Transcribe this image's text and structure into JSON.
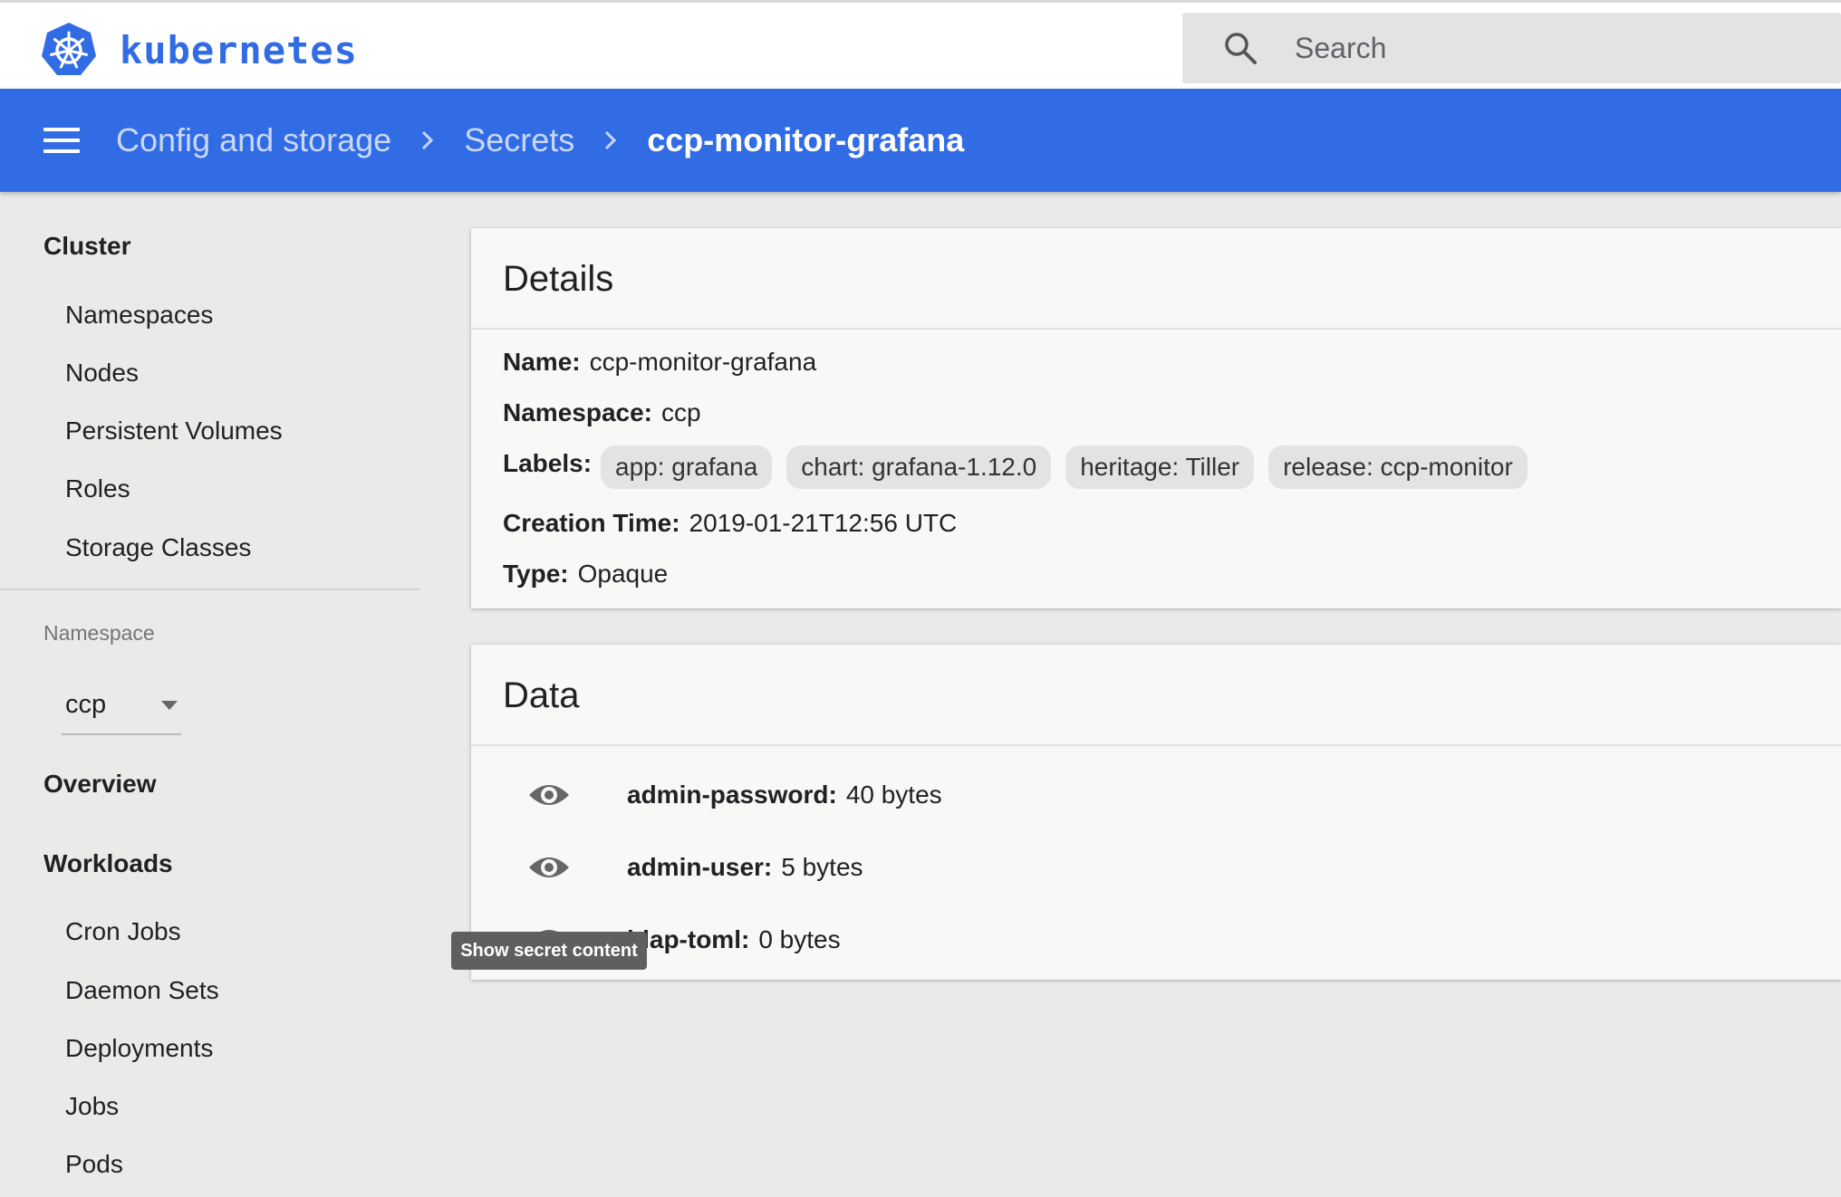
{
  "brand": "kubernetes",
  "search": {
    "placeholder": "Search"
  },
  "breadcrumb": [
    {
      "label": "Config and storage"
    },
    {
      "label": "Secrets"
    },
    {
      "label": "ccp-monitor-grafana"
    }
  ],
  "sidebar": {
    "cluster_heading": "Cluster",
    "cluster_items": [
      "Namespaces",
      "Nodes",
      "Persistent Volumes",
      "Roles",
      "Storage Classes"
    ],
    "namespace_label": "Namespace",
    "namespace_value": "ccp",
    "overview": "Overview",
    "workloads_heading": "Workloads",
    "workloads_items": [
      "Cron Jobs",
      "Daemon Sets",
      "Deployments",
      "Jobs",
      "Pods"
    ]
  },
  "details": {
    "title": "Details",
    "name_label": "Name:",
    "name_value": "ccp-monitor-grafana",
    "namespace_label": "Namespace:",
    "namespace_value": "ccp",
    "labels_label": "Labels:",
    "labels": [
      "app: grafana",
      "chart: grafana-1.12.0",
      "heritage: Tiller",
      "release: ccp-monitor"
    ],
    "creation_label": "Creation Time:",
    "creation_value": "2019-01-21T12:56 UTC",
    "type_label": "Type:",
    "type_value": "Opaque"
  },
  "data": {
    "title": "Data",
    "entries": [
      {
        "key": "admin-password:",
        "value": "40 bytes"
      },
      {
        "key": "admin-user:",
        "value": "5 bytes"
      },
      {
        "key": "ldap-toml:",
        "value": "0 bytes"
      }
    ]
  },
  "tooltip": "Show secret content",
  "colors": {
    "accent": "#326ce5",
    "background": "#e9ebe8",
    "card": "#f7f9f6"
  }
}
